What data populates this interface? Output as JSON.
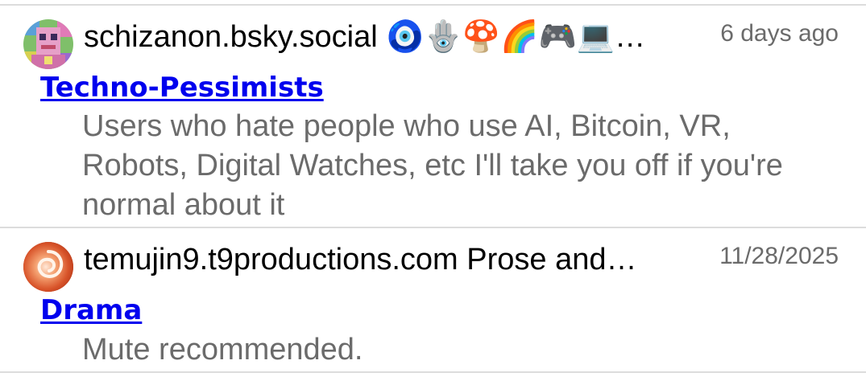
{
  "items": [
    {
      "handle": "schizanon.bsky.social 🧿🪬🍄🌈🎮💻…",
      "timestamp": "6 days ago",
      "list_title": "Techno-Pessimists",
      "description": "Users who hate people who use AI, Bitcoin, VR, Robots, Digital Watches, etc I'll take you off if you're normal about it",
      "avatar_icon": "pixel-art-avatar-icon"
    },
    {
      "handle": "temujin9.t9productions.com Prose and…",
      "timestamp": "11/28/2025",
      "list_title": "Drama",
      "description": "Mute recommended.",
      "avatar_icon": "orange-swirl-avatar-icon"
    }
  ],
  "colors": {
    "link": "#0000ee",
    "secondary_text": "#6b6b6b",
    "divider": "#dcdcdc"
  }
}
